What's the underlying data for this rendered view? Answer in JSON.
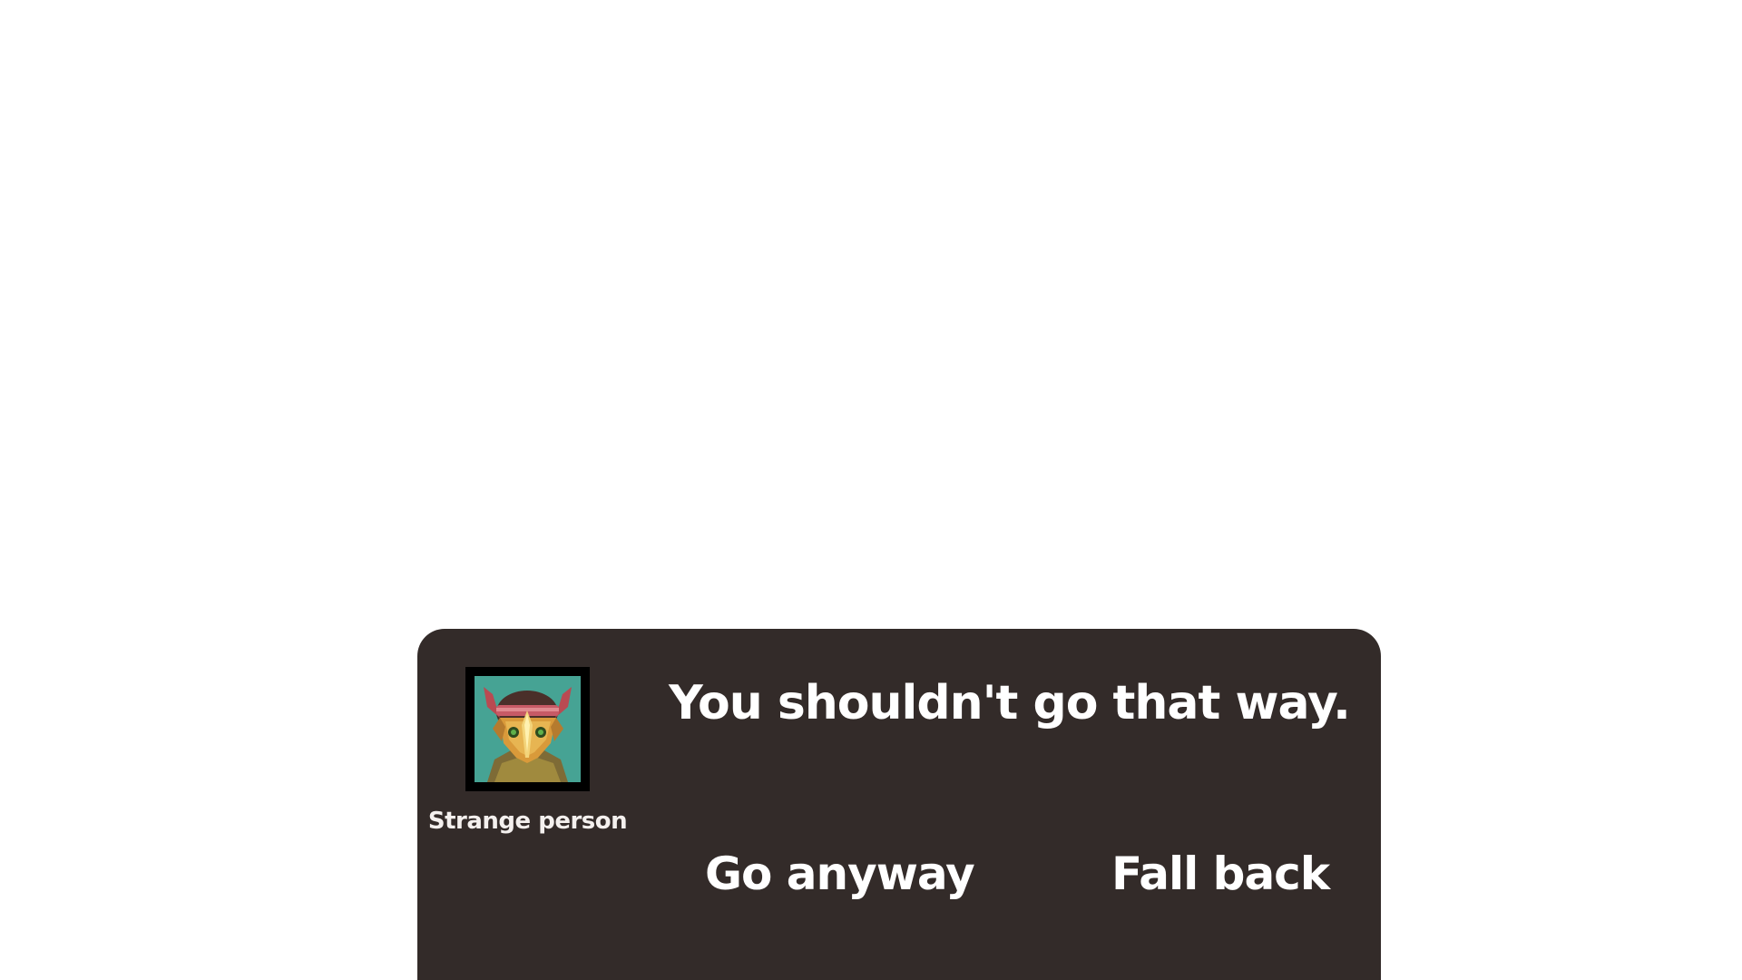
{
  "dialog": {
    "speaker": "Strange person",
    "portrait": "masked-creature-portrait",
    "message": "You shouldn't go that way.",
    "choices": [
      "Go anyway",
      "Fall back"
    ]
  },
  "colors": {
    "panel": "#332b29",
    "text": "#ffffff",
    "portrait_bg": "#46a394",
    "portrait_frame": "#000000"
  }
}
